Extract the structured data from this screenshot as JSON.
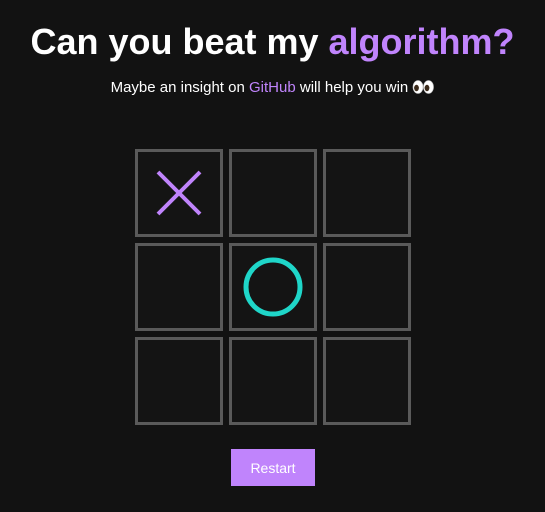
{
  "header": {
    "title_prefix": "Can you beat my ",
    "title_accent": "algorithm?",
    "subtitle_prefix": "Maybe an insight on ",
    "subtitle_link": "GitHub",
    "subtitle_suffix": " will help you win ",
    "subtitle_emoji": "eyes"
  },
  "board": {
    "cells": [
      "X",
      "",
      "",
      "",
      "O",
      "",
      "",
      "",
      ""
    ]
  },
  "controls": {
    "restart_label": "Restart"
  },
  "colors": {
    "background": "#121212",
    "accent": "#c084fc",
    "x_mark": "#c084fc",
    "o_mark": "#1fd6c9",
    "cell_border": "#5a5a5a"
  }
}
